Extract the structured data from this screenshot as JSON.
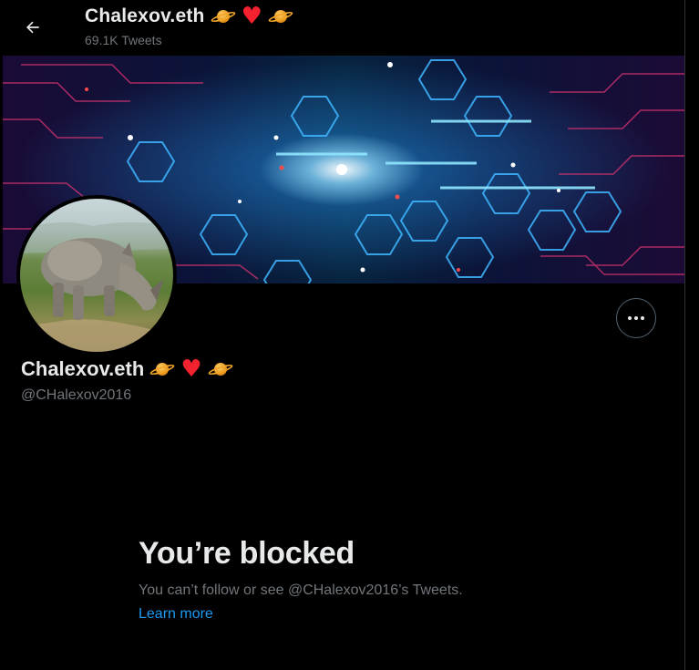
{
  "header": {
    "back_icon": "arrow-left-icon",
    "name": "Chalexov.eth",
    "tweets_count": "69.1K Tweets",
    "emojis": [
      "ringed-planet-icon",
      "heart-icon",
      "ringed-planet-icon"
    ]
  },
  "banner": {
    "description_icon": "circuit-banner"
  },
  "avatar": {
    "icon": "rhino-avatar"
  },
  "actions": {
    "more_icon": "more-horizontal-icon"
  },
  "profile": {
    "name": "Chalexov.eth",
    "handle": "@CHalexov2016"
  },
  "blocked": {
    "title": "You’re blocked",
    "message": "You can’t follow or see @CHalexov2016’s Tweets.",
    "link": "Learn more"
  },
  "colors": {
    "background": "#000000",
    "text": "#e7e9ea",
    "muted": "#71767b",
    "link": "#1d9bf0",
    "heart": "#f4212e"
  }
}
